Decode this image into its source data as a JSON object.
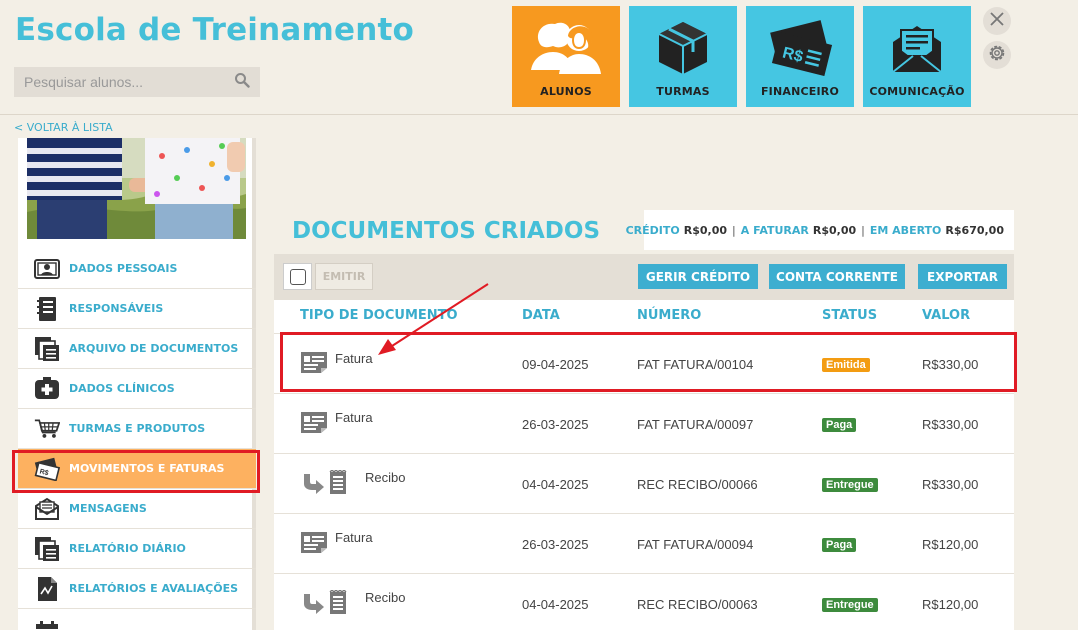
{
  "app": {
    "title": "Escola de Treinamento"
  },
  "search": {
    "placeholder": "Pesquisar alunos..."
  },
  "nav": [
    {
      "label": "ALUNOS",
      "icon": "students-icon",
      "active": true
    },
    {
      "label": "TURMAS",
      "icon": "box-icon",
      "active": false
    },
    {
      "label": "FINANCEIRO",
      "icon": "money-icon",
      "active": false
    },
    {
      "label": "COMUNICAÇÃO",
      "icon": "envelope-icon",
      "active": false
    }
  ],
  "back_link": "< VOLTAR À LISTA",
  "sidebar": {
    "items": [
      {
        "label": "DADOS PESSOAIS",
        "icon": "id-card-icon"
      },
      {
        "label": "RESPONSÁVEIS",
        "icon": "notebook-icon"
      },
      {
        "label": "ARQUIVO DE DOCUMENTOS",
        "icon": "documents-icon"
      },
      {
        "label": "DADOS CLÍNICOS",
        "icon": "medical-cross-icon"
      },
      {
        "label": "TURMAS E PRODUTOS",
        "icon": "cart-icon"
      },
      {
        "label": "MOVIMENTOS E FATURAS",
        "icon": "money-icon",
        "active": true
      },
      {
        "label": "MENSAGENS",
        "icon": "envelope-icon"
      },
      {
        "label": "RELATÓRIO DIÁRIO",
        "icon": "documents-icon"
      },
      {
        "label": "RELATÓRIOS E AVALIAÇÕES",
        "icon": "report-icon"
      }
    ]
  },
  "documents": {
    "title": "DOCUMENTOS CRIADOS",
    "totals": [
      {
        "label": "CRÉDITO",
        "value": "R$0,00"
      },
      {
        "label": "A FATURAR",
        "value": "R$0,00"
      },
      {
        "label": "EM ABERTO",
        "value": "R$670,00"
      }
    ],
    "toolbar": {
      "emit": "EMITIR",
      "manage_credit": "GERIR CRÉDITO",
      "current_account": "CONTA CORRENTE",
      "export": "EXPORTAR"
    },
    "columns": [
      "TIPO DE DOCUMENTO",
      "DATA",
      "NÚMERO",
      "STATUS",
      "VALOR"
    ],
    "rows": [
      {
        "type": "Fatura",
        "icon": "invoice-icon",
        "date": "09-04-2025",
        "number": "FAT FATURA/00104",
        "status": "Emitida",
        "status_color": "#f39c12",
        "value": "R$330,00"
      },
      {
        "type": "Fatura",
        "icon": "invoice-icon",
        "date": "26-03-2025",
        "number": "FAT FATURA/00097",
        "status": "Paga",
        "status_color": "#3d8b3d",
        "value": "R$330,00"
      },
      {
        "type": "Recibo",
        "icon": "receipt-icon",
        "date": "04-04-2025",
        "number": "REC RECIBO/00066",
        "status": "Entregue",
        "status_color": "#3d8b3d",
        "value": "R$330,00"
      },
      {
        "type": "Fatura",
        "icon": "invoice-icon",
        "date": "26-03-2025",
        "number": "FAT FATURA/00094",
        "status": "Paga",
        "status_color": "#3d8b3d",
        "value": "R$120,00"
      },
      {
        "type": "Recibo",
        "icon": "receipt-icon",
        "date": "04-04-2025",
        "number": "REC RECIBO/00063",
        "status": "Entregue",
        "status_color": "#3d8b3d",
        "value": "R$120,00"
      }
    ]
  },
  "colors": {
    "accent": "#45bfd8",
    "active_tile": "#f7991f",
    "highlight": "#e01b24",
    "button": "#3daed0"
  }
}
